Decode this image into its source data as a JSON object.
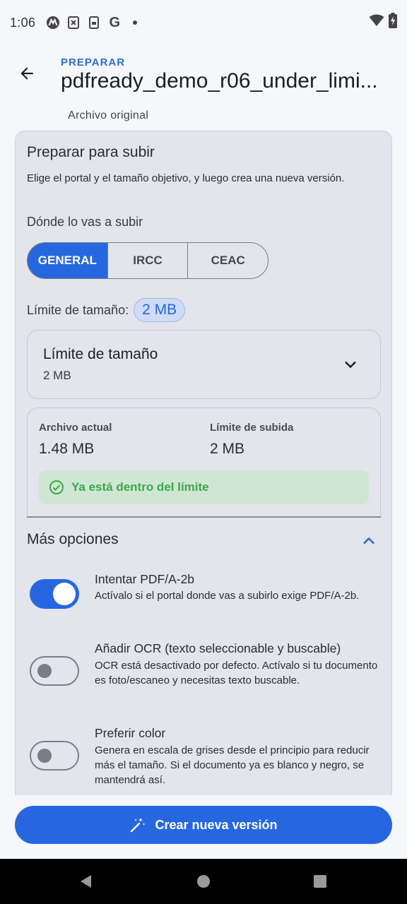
{
  "status_bar": {
    "time": "1:06",
    "icons": [
      "motorola-icon",
      "notification-icon",
      "sim-icon",
      "google-icon",
      "dot-icon",
      "wifi-icon",
      "battery-charging-icon"
    ]
  },
  "app_bar": {
    "eyebrow": "PREPARAR",
    "title": "pdfready_demo_r06_under_limi...",
    "subtitle": "Archivo original",
    "back_icon": "arrow-back-icon"
  },
  "card": {
    "title": "Preparar para subir",
    "description": "Elige el portal y el tamaño objetivo, y luego crea una nueva versión.",
    "portal_label": "Dónde lo vas a subir",
    "portals": [
      {
        "label": "GENERAL",
        "selected": true
      },
      {
        "label": "IRCC",
        "selected": false
      },
      {
        "label": "CEAC",
        "selected": false
      }
    ],
    "size_limit_label": "Límite de tamaño:",
    "size_limit_chip": "2 MB",
    "dropdown": {
      "title": "Límite de tamaño",
      "value": "2 MB",
      "icon": "chevron-down-icon"
    },
    "info": {
      "current_label": "Archivo actual",
      "current_value": "1.48 MB",
      "limit_label": "Límite de subida",
      "limit_value": "2 MB",
      "status": "Ya está dentro del límite",
      "status_icon": "check-circle-icon",
      "status_color": "#3ca84a"
    },
    "more_options": {
      "title": "Más opciones",
      "expanded": true,
      "icon": "chevron-up-icon",
      "options": [
        {
          "title": "Intentar PDF/A-2b",
          "description": "Actívalo si el portal donde vas a subirlo exige PDF/A-2b.",
          "enabled": true
        },
        {
          "title": "Añadir OCR (texto seleccionable y buscable)",
          "description": "OCR está desactivado por defecto. Actívalo si tu documento es foto/escaneo y necesitas texto buscable.",
          "enabled": false
        },
        {
          "title": "Preferir color",
          "description": "Genera en escala de grises desde el principio para reducir más el tamaño. Si el documento ya es blanco y negro, se mantendrá así.",
          "enabled": false
        }
      ]
    }
  },
  "cta": {
    "label": "Crear nueva versión",
    "icon": "magic-wand-icon"
  },
  "colors": {
    "accent": "#2667e0",
    "eyebrow": "#2c6fc7",
    "success_bg": "#cfe6d3",
    "card_bg": "#e3e4ec"
  },
  "nav_bar": {
    "buttons": [
      "back-triangle-icon",
      "home-circle-icon",
      "recents-square-icon"
    ]
  }
}
